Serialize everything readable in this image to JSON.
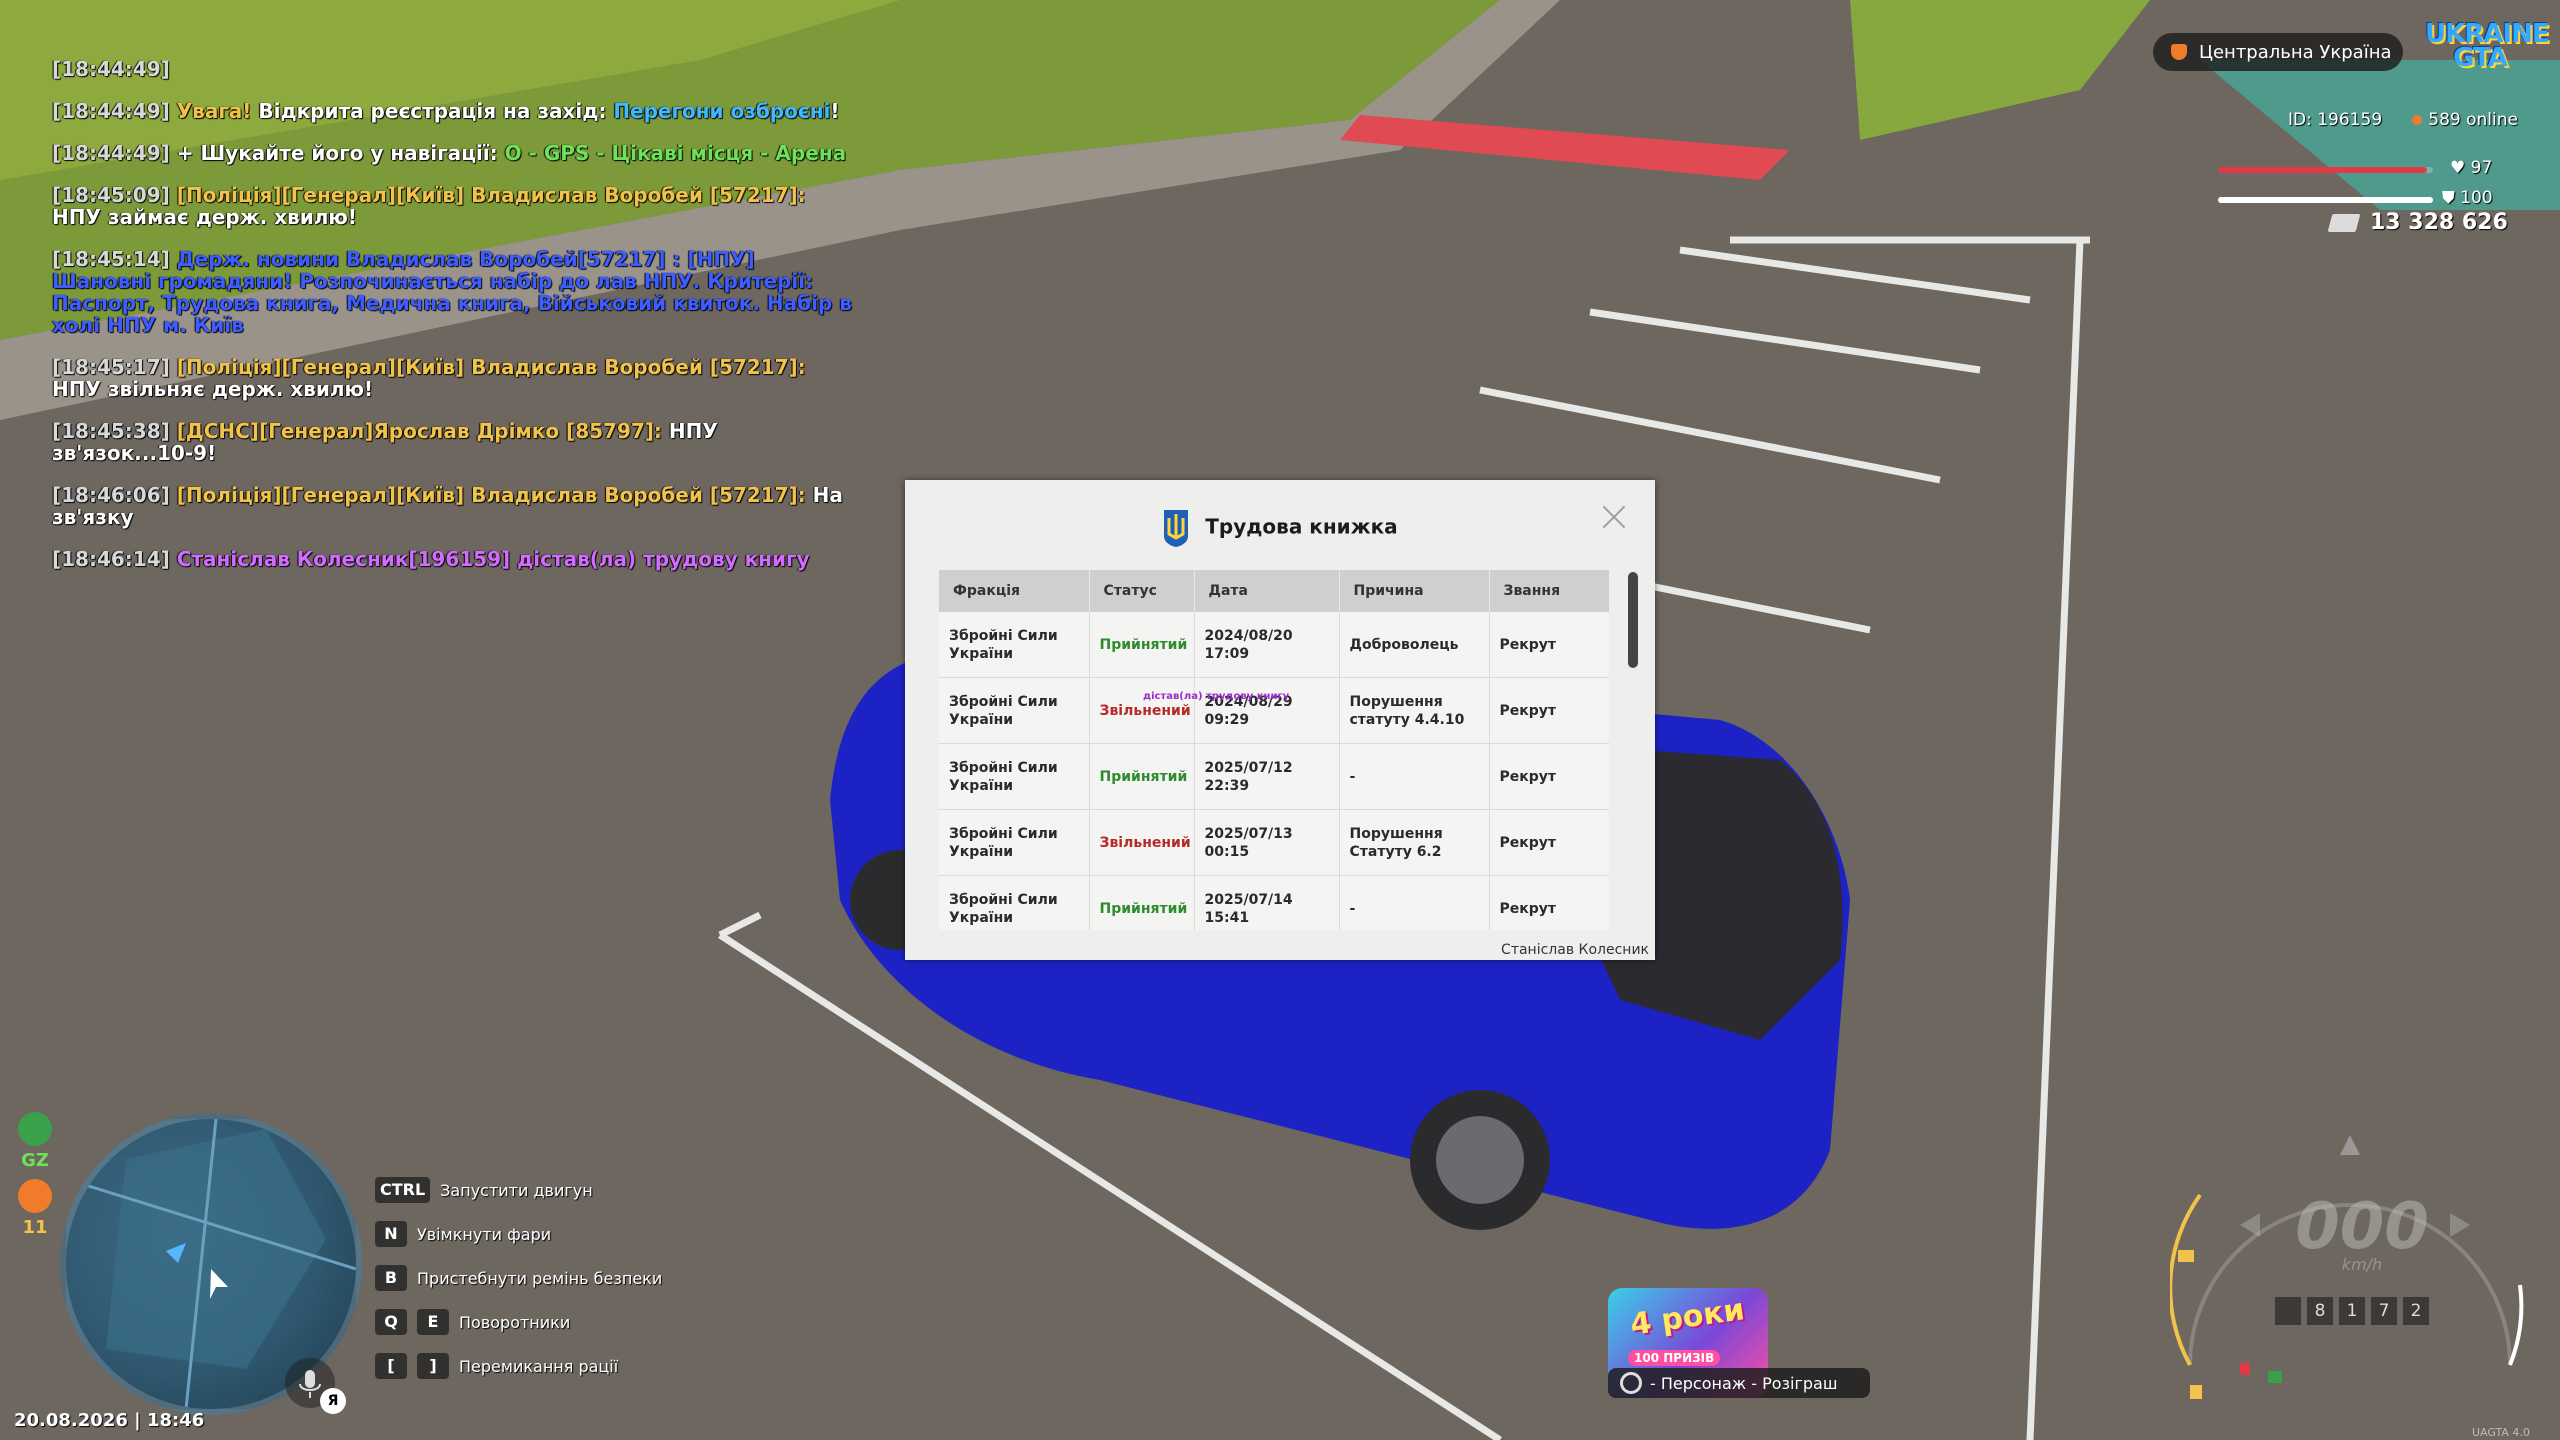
{
  "chat": [
    {
      "ts": "[18:44:49]",
      "parts": []
    },
    {
      "ts": "[18:44:49]",
      "parts": [
        {
          "t": "Увага!",
          "c": "yellow"
        },
        {
          "t": " Відкрита реєстрація на захід: ",
          "c": "white"
        },
        {
          "t": "Перегони озброєні",
          "c": "cyan"
        },
        {
          "t": "!",
          "c": "white"
        }
      ]
    },
    {
      "ts": "[18:44:49]",
      "parts": [
        {
          "t": "+ Шукайте його у навігації: ",
          "c": "white"
        },
        {
          "t": "O - GPS - Цікаві місця - Арена",
          "c": "green"
        }
      ]
    },
    {
      "ts": "[18:45:09]",
      "parts": [
        {
          "t": "[Поліція][Генерал][Київ] Владислав Воробей [57217]:",
          "c": "yellow"
        },
        {
          "t": " НПУ займає держ. хвилю!",
          "c": "white"
        }
      ]
    },
    {
      "ts": "[18:45:14]",
      "parts": [
        {
          "t": "Держ. новини Владислав Воробей[57217] : [НПУ] Шановні громадяни! Розпочинається набір до лав НПУ. Критерії: Паспорт, Трудова книга, Медична книга, Військовий квиток. Набір в холі НПУ м. Київ",
          "c": "blue"
        }
      ]
    },
    {
      "ts": "[18:45:17]",
      "parts": [
        {
          "t": "[Поліція][Генерал][Київ] Владислав Воробей [57217]:",
          "c": "yellow"
        },
        {
          "t": " НПУ звільняє держ. хвилю!",
          "c": "white"
        }
      ]
    },
    {
      "ts": "[18:45:38]",
      "parts": [
        {
          "t": "[ДСНС][Генерал]Ярослав Дрімко [85797]:",
          "c": "yellow"
        },
        {
          "t": " НПУ зв'язок...10-9!",
          "c": "white"
        }
      ]
    },
    {
      "ts": "[18:46:06]",
      "parts": [
        {
          "t": "[Поліція][Генерал][Київ] Владислав Воробей [57217]:",
          "c": "yellow"
        },
        {
          "t": " На зв'язку",
          "c": "white"
        }
      ]
    },
    {
      "ts": "[18:46:14]",
      "parts": [
        {
          "t": "Станіслав Колесник[196159] дістав(ла) трудову книгу",
          "c": "purple"
        }
      ]
    }
  ],
  "hud": {
    "region": "Центральна Україна",
    "logo_line1": "UKRAINE",
    "logo_line2": "GTA",
    "player_id": "ID: 196159",
    "online": "589 online",
    "health": "97",
    "health_level": 0.97,
    "armor": "100",
    "armor_level": 1.0,
    "money": "13 328 626"
  },
  "modal": {
    "title": "Трудова книжка",
    "columns": [
      "Фракція",
      "Статус",
      "Дата",
      "Причина",
      "Звання"
    ],
    "rows": [
      {
        "faction": "Збройні Сили України",
        "status": "Прийнятий",
        "status_kind": "ok",
        "date": "2024/08/20 17:09",
        "reason": "Доброволець",
        "rank": "Рекрут"
      },
      {
        "faction": "Збройні Сили України",
        "status": "Звільнений",
        "status_kind": "bad",
        "date": "2024/08/29 09:29",
        "reason": "Порушення статуту 4.4.10",
        "rank": "Рекрут"
      },
      {
        "faction": "Збройні Сили України",
        "status": "Прийнятий",
        "status_kind": "ok",
        "date": "2025/07/12 22:39",
        "reason": "-",
        "rank": "Рекрут"
      },
      {
        "faction": "Збройні Сили України",
        "status": "Звільнений",
        "status_kind": "bad",
        "date": "2025/07/13 00:15",
        "reason": "Порушення Статуту 6.2",
        "rank": "Рекрут"
      },
      {
        "faction": "Збройні Сили України",
        "status": "Прийнятий",
        "status_kind": "ok",
        "date": "2025/07/14 15:41",
        "reason": "-",
        "rank": "Рекрут"
      }
    ],
    "owner": "Станіслав Колесник",
    "overlay_text": "дістав(ла) трудову книгу"
  },
  "side": {
    "gz_label": "GZ",
    "count": "11",
    "mic_badge": "Я"
  },
  "datetime": "20.08.2026 | 18:46",
  "hints": [
    {
      "keys": [
        "CTRL"
      ],
      "label": "Запустити двигун"
    },
    {
      "keys": [
        "N"
      ],
      "label": "Увімкнути фари"
    },
    {
      "keys": [
        "B"
      ],
      "label": "Пристебнути ремінь безпеки"
    },
    {
      "keys": [
        "Q",
        "E"
      ],
      "label": "Поворотники"
    },
    {
      "keys": [
        "[",
        "]"
      ],
      "label": "Перемикання рації"
    }
  ],
  "promo": {
    "headline": "4 роки",
    "sub": "100 ПРИЗІВ",
    "action": "- Персонаж - Розіграш"
  },
  "speedo": {
    "speed": "000",
    "unit": "km/h",
    "odometer": [
      "",
      "8",
      "1",
      "7",
      "2"
    ]
  },
  "version": "UAGTA 4.0",
  "colors": {
    "yellow": "#f1c34a",
    "white": "#ffffff",
    "cyan": "#3fb8ff",
    "green": "#6ee05a",
    "blue": "#3d5dff",
    "purple": "#d36bff",
    "health": "#e03a46",
    "armor": "#ffffff"
  }
}
